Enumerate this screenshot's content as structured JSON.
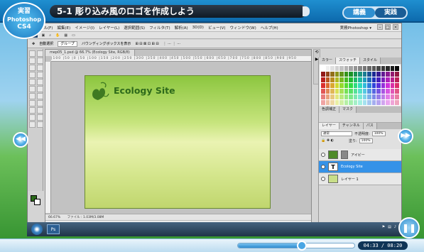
{
  "badge": {
    "line1": "実習",
    "line2": "Photoshop",
    "line3": "CS4"
  },
  "chapter_title": "5-1 彫り込み風のロゴを作成しよう",
  "tabs": [
    {
      "label": "講義"
    },
    {
      "label": "実践"
    }
  ],
  "photoshop": {
    "menu": [
      "ファイル(F)",
      "編集(E)",
      "イメージ(I)",
      "レイヤー(L)",
      "選択範囲(S)",
      "フィルタ(T)",
      "解析(A)",
      "3D(D)",
      "ビュー(V)",
      "ウィンドウ(W)",
      "ヘルプ(H)"
    ],
    "workspace": "実務Photoshop ▾",
    "options": {
      "auto_select": "自動選択",
      "group": "グループ",
      "transform": "バウンディングボックスを表示"
    },
    "doc_tab": "mep05_1.psd @ 66.7% (Ecology Site, RGB/8)",
    "canvas_text": "Ecology Site",
    "status": {
      "zoom": "66.67%",
      "file": "ファイル : 1.03M/3.08M"
    },
    "panel_tabs_top": [
      "カラー",
      "スウォッチ",
      "スタイル"
    ],
    "panel_tabs_adjust": [
      "色調補正",
      "マスク"
    ],
    "panel_tabs_layers": [
      "レイヤー",
      "チャンネル",
      "パス"
    ],
    "blend_mode": "通常",
    "opacity_label": "不透明度:",
    "opacity": "100%",
    "fill_label": "塗り:",
    "fill": "100%",
    "layers": [
      {
        "name": "アイビー",
        "selected": false,
        "thumb": "#4e8a2a"
      },
      {
        "name": "Ecology Site",
        "selected": true,
        "thumb": "text"
      },
      {
        "name": "レイヤー 1",
        "selected": false,
        "thumb": "#c8de88"
      }
    ]
  },
  "player": {
    "time": "04:33 / 08:20",
    "progress": 0.55
  },
  "colors": {
    "accent": "#2f8fd0",
    "canvas_text": "#2e6a1b"
  }
}
